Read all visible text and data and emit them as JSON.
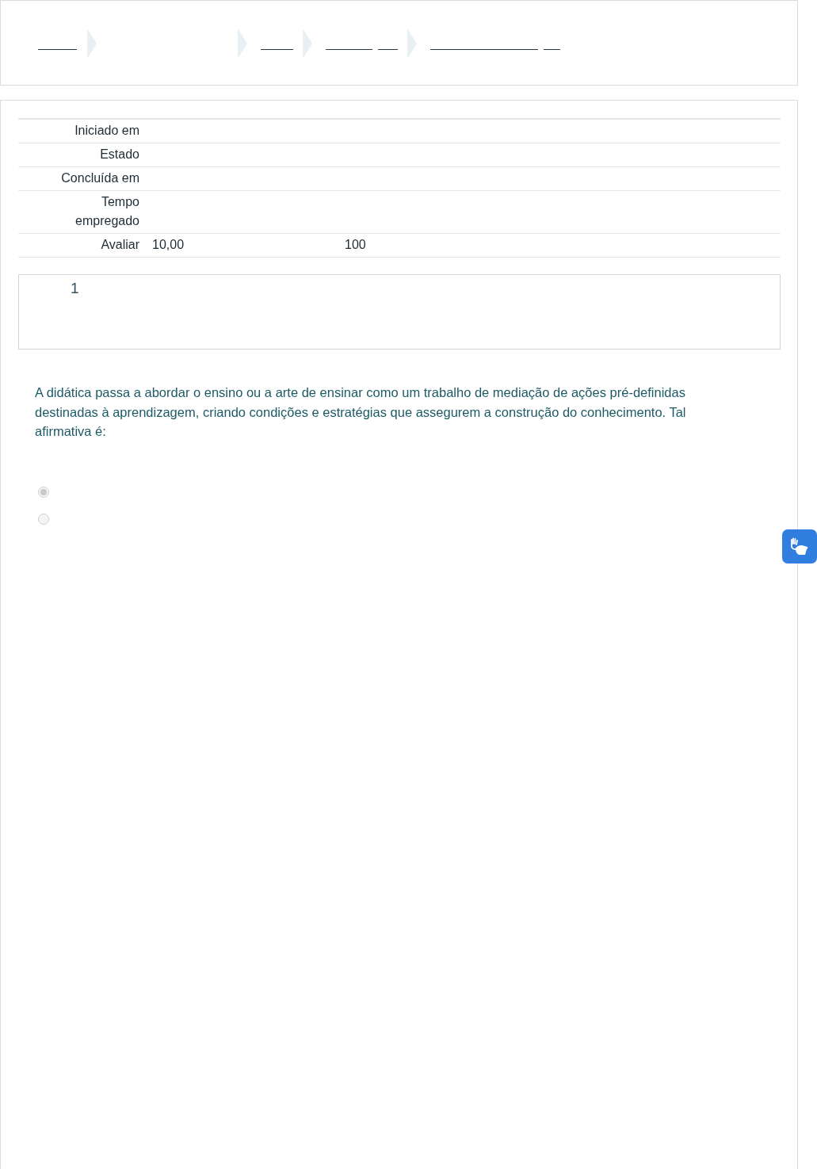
{
  "summary": [
    {
      "label": "Iniciado em"
    },
    {
      "label": "Estado"
    },
    {
      "label": "Concluída em"
    },
    {
      "label": "Tempo empregado"
    },
    {
      "label": "Avaliar",
      "values": [
        "10,00",
        "100"
      ]
    }
  ],
  "question": {
    "number": "1",
    "text": "A didática passa a abordar o ensino ou a arte de ensinar como um trabalho de mediação de ações pré-definidas destinadas à aprendizagem, criando condições e estratégias que assegurem a construção do conhecimento. Tal afirmativa é:",
    "options": [
      {
        "selected": true,
        "disabled": true
      },
      {
        "selected": false,
        "disabled": true
      }
    ]
  }
}
